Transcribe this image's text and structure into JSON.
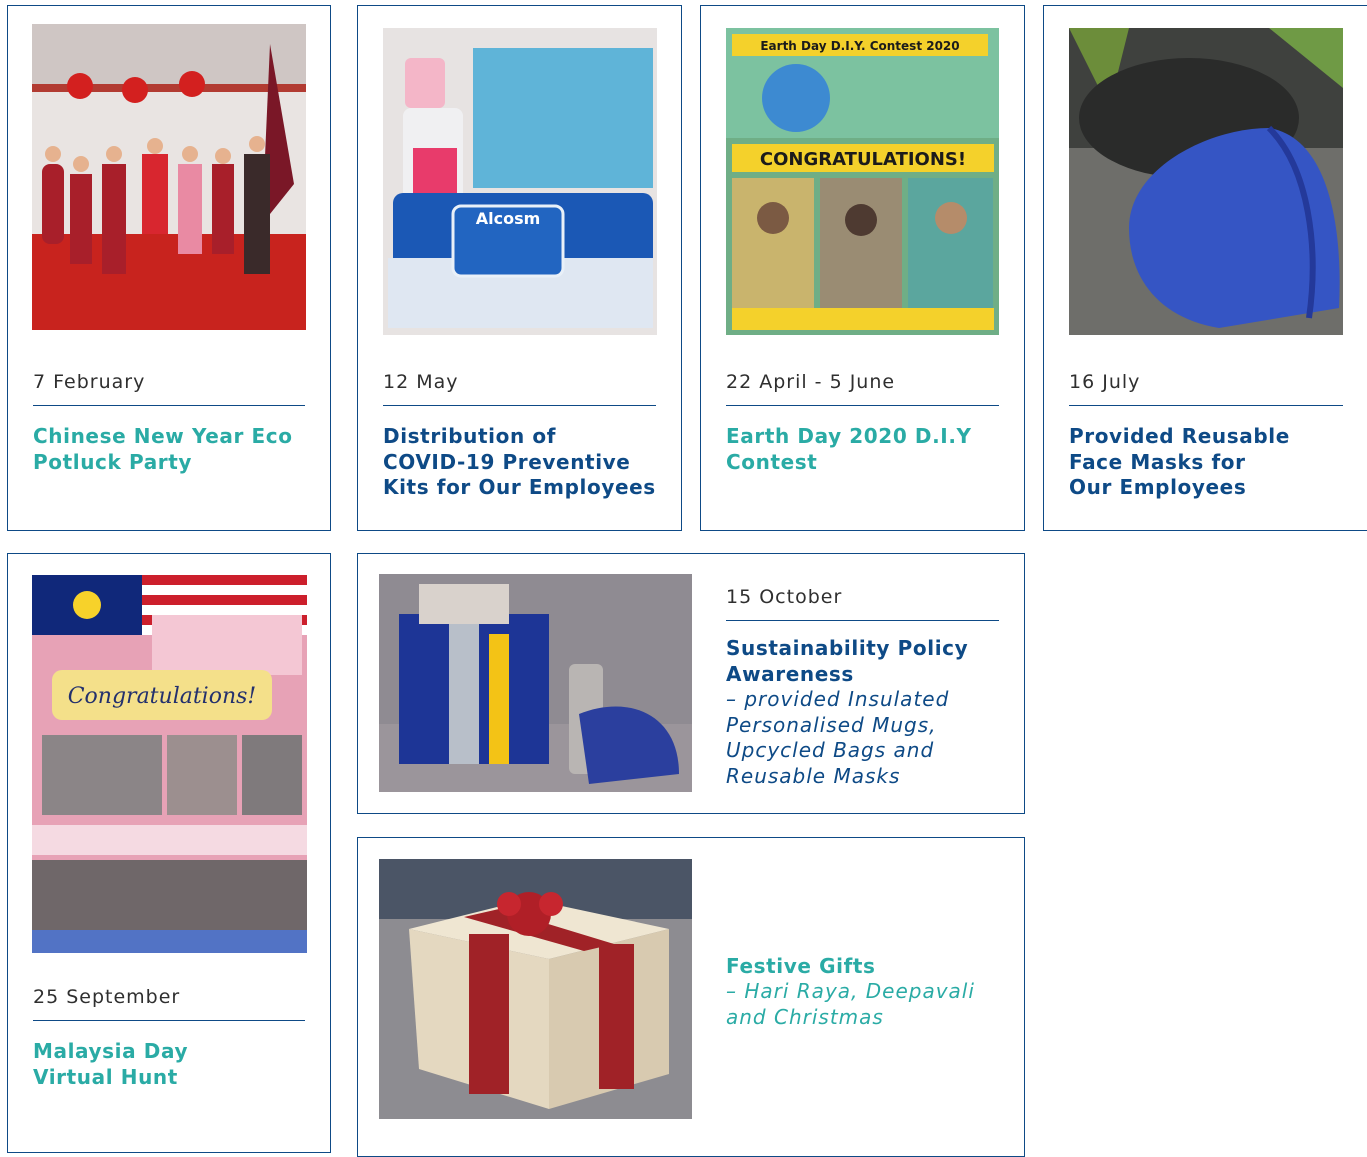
{
  "colors": {
    "border": "#0e4a86",
    "teal": "#2aaba5",
    "navy": "#0e4a86"
  },
  "cards": [
    {
      "date": "7 February",
      "title": [
        "Chinese New Year Eco",
        "Potluck Party"
      ],
      "image": "photo of group of people in red clothing under red lanterns"
    },
    {
      "date": "12 May",
      "title": [
        "Distribution of",
        "COVID-19 Preventive",
        "Kits for Our Employees"
      ],
      "image": "photo of sanitizer bottle, face masks and Alcosm disinfectant wipes",
      "image_text": "Alcosm"
    },
    {
      "date": "22 April - 5 June",
      "title": [
        "Earth Day 2020 D.I.Y",
        "Contest"
      ],
      "image": "Earth Day contest congratulations poster",
      "image_text": [
        "Earth Day D.I.Y. Contest 2020",
        "CONGRATULATIONS!"
      ]
    },
    {
      "date": "16 July",
      "title": [
        "Provided Reusable",
        "Face Masks for",
        "Our Employees"
      ],
      "image": "photo of blue reusable face mask"
    },
    {
      "date": "25 September",
      "title": [
        "Malaysia Day",
        "Virtual Hunt"
      ],
      "image": "Malaysia Day congratulations poster",
      "image_text": "Congratulations!"
    },
    {
      "date": "15 October",
      "title": [
        "Sustainability Policy",
        "Awareness"
      ],
      "subtitle": [
        "– provided Insulated",
        "Personalised Mugs,",
        "Upcycled Bags and",
        "Reusable Masks"
      ],
      "image": "photo of upcycled bag, insulated mug and mask"
    },
    {
      "date": "",
      "title": [
        "Festive Gifts"
      ],
      "subtitle": [
        "– Hari Raya, Deepavali",
        "and Christmas"
      ],
      "image": "photo of wooden gift box with red ribbon"
    }
  ]
}
